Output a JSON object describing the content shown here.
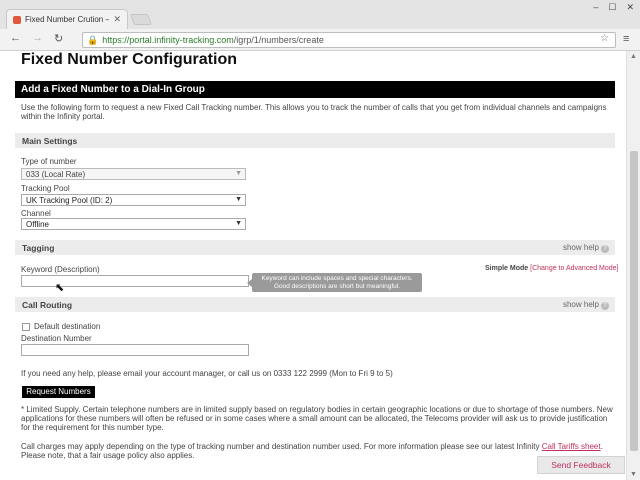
{
  "browser": {
    "tab_title": "Fixed Number Crution – I",
    "tab_close": "✕",
    "url_scheme": "https://",
    "url_host": "portal.infinity-tracking.com",
    "url_path": "/igrp/1/numbers/create",
    "win_min": "–",
    "win_max": "☐",
    "win_close": "✕"
  },
  "page": {
    "title": "Fixed Number Configuration",
    "section_header": "Add a Fixed Number to a Dial-In Group",
    "intro": "Use the following form to request a new Fixed Call Tracking number. This allows you to track the number of calls that you get from individual channels and campaigns within the Infinity portal."
  },
  "main_settings": {
    "header": "Main Settings",
    "type_label": "Type of number",
    "type_value": "033 (Local Rate)",
    "pool_label": "Tracking Pool",
    "pool_value": "UK Tracking Pool (ID: 2)",
    "channel_label": "Channel",
    "channel_value": "Offline"
  },
  "tagging": {
    "header": "Tagging",
    "show_help": "show help",
    "keyword_label": "Keyword (Description)",
    "tooltip_line1": "Keyword can include spaces and special characters.",
    "tooltip_line2": "Good descriptions are short but meaningful.",
    "simple_mode": "Simple Mode",
    "change_mode": "[Change to Advanced Mode]"
  },
  "call_routing": {
    "header": "Call Routing",
    "show_help": "show help",
    "default_destination": "Default destination",
    "destination_label": "Destination Number"
  },
  "footer": {
    "help_text": "If you need any help, please email your account manager, or call us on 0333 122 2999 (Mon to Fri 9 to 5)",
    "request_button": "Request Numbers",
    "limited_supply": "* Limited Supply. Certain telephone numbers are in limited supply based on regulatory bodies in certain geographic locations or due to shortage of those numbers. New applications for these numbers will often be refused or in some cases where a small amount can be allocated, the Telecoms provider will ask us to provide justification for the requirement for this number type.",
    "charges_text": "Call charges may apply depending on the type of tracking number and destination number used. For more information please see our latest Infinity",
    "tariffs_link": "Call Tariffs sheet",
    "charges_tail": ". Please note, that a fair usage policy also applies.",
    "feedback": "Send Feedback"
  },
  "colors": {
    "accent_link": "#c0305a",
    "header_bar": "#000000",
    "section_bar": "#ececec"
  }
}
